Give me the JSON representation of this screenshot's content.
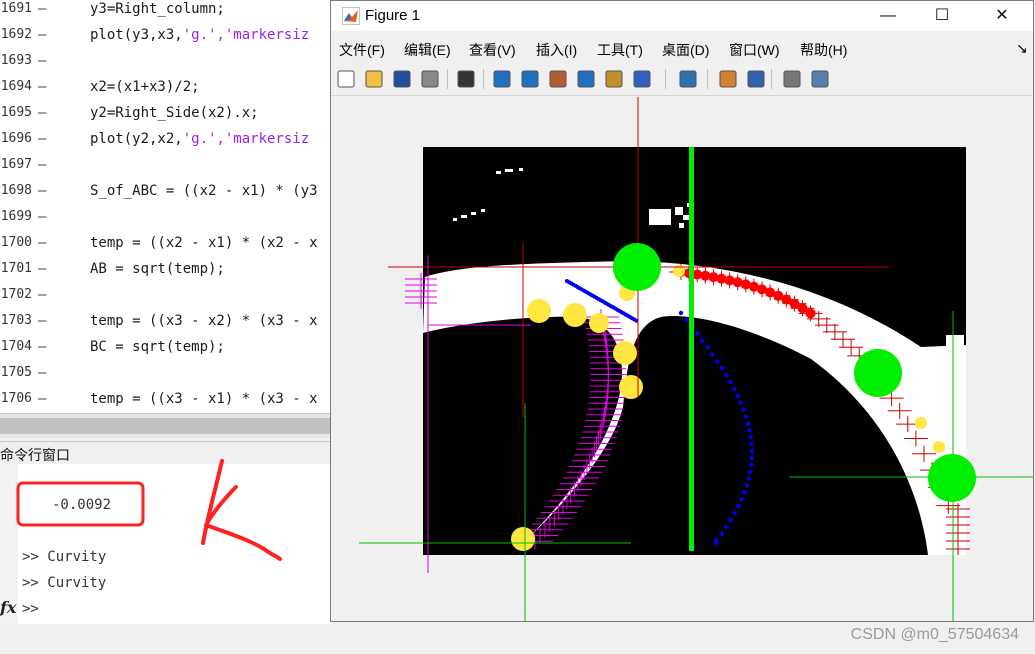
{
  "editor": {
    "lines": [
      {
        "num": "1691",
        "text": "y3=Right_column;",
        "str": ""
      },
      {
        "num": "1692",
        "text": "plot(y3,x3,",
        "str": "'g.','markersiz"
      },
      {
        "num": "1693",
        "text": "",
        "str": ""
      },
      {
        "num": "1694",
        "text": "x2=(x1+x3)/2;",
        "str": ""
      },
      {
        "num": "1695",
        "text": "y2=Right_Side(x2).x;",
        "str": ""
      },
      {
        "num": "1696",
        "text": "plot(y2,x2,",
        "str": "'g.','markersiz"
      },
      {
        "num": "1697",
        "text": "",
        "str": ""
      },
      {
        "num": "1698",
        "text": "S_of_ABC = ((x2 - x1) * (y3",
        "str": ""
      },
      {
        "num": "1699",
        "text": "",
        "str": ""
      },
      {
        "num": "1700",
        "text": "temp = ((x2 - x1) * (x2 - x",
        "str": ""
      },
      {
        "num": "1701",
        "text": "AB = sqrt(temp);",
        "str": ""
      },
      {
        "num": "1702",
        "text": "",
        "str": ""
      },
      {
        "num": "1703",
        "text": "temp = ((x3 - x2) * (x3 - x",
        "str": ""
      },
      {
        "num": "1704",
        "text": "BC = sqrt(temp);",
        "str": ""
      },
      {
        "num": "1705",
        "text": "",
        "str": ""
      },
      {
        "num": "1706",
        "text": "temp = ((x3 - x1) * (x3 - x",
        "str": ""
      }
    ],
    "dash": "—"
  },
  "command_window": {
    "title": "命令行窗口",
    "result": "-0.0092",
    "history": [
      ">> Curvity",
      ">> Curvity"
    ],
    "prompt": ">>",
    "fx": "fx"
  },
  "figure": {
    "title": "Figure 1",
    "menus": [
      "文件(F)",
      "编辑(E)",
      "查看(V)",
      "插入(I)",
      "工具(T)",
      "桌面(D)",
      "窗口(W)",
      "帮助(H)"
    ],
    "toolbar_icons": [
      "new-figure-icon",
      "open-file-icon",
      "save-icon",
      "print-icon",
      "pointer-icon",
      "zoom-in-icon",
      "zoom-out-icon",
      "pan-icon",
      "rotate-icon",
      "data-cursor-icon",
      "brush-icon",
      "link-plot-icon",
      "colorbar-icon",
      "legend-icon",
      "hide-tools-icon",
      "show-tools-icon"
    ],
    "colors": {
      "green": "#00ff00",
      "red": "#ff0000",
      "yellow": "#ffe640",
      "blue": "#0000ee",
      "magenta": "#e000e0"
    }
  },
  "watermark": "CSDN @m0_57504634"
}
